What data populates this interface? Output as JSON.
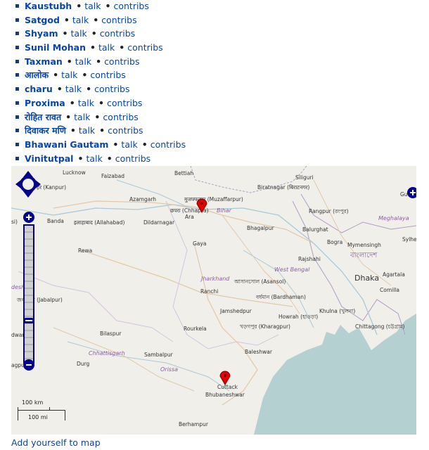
{
  "users": [
    {
      "name": "Kaustubh",
      "talk": "talk",
      "contribs": "contribs"
    },
    {
      "name": "Satgod",
      "talk": "talk",
      "contribs": "contribs"
    },
    {
      "name": "Shyam",
      "talk": "talk",
      "contribs": "contribs"
    },
    {
      "name": "Sunil Mohan",
      "talk": "talk",
      "contribs": "contribs"
    },
    {
      "name": "Taxman",
      "talk": "talk",
      "contribs": "contribs"
    },
    {
      "name": "आलोक",
      "talk": "talk",
      "contribs": "contribs"
    },
    {
      "name": "charu",
      "talk": "talk",
      "contribs": "contribs"
    },
    {
      "name": "Proxima",
      "talk": "talk",
      "contribs": "contribs"
    },
    {
      "name": "रोहित रावत",
      "talk": "talk",
      "contribs": "contribs"
    },
    {
      "name": "दिवाकर मणि",
      "talk": "talk",
      "contribs": "contribs"
    },
    {
      "name": "Bhawani Gautam",
      "talk": "talk",
      "contribs": "contribs"
    },
    {
      "name": "Vinitutpal",
      "talk": "talk",
      "contribs": "contribs"
    }
  ],
  "separator": "•",
  "map": {
    "places": {
      "lucknow": "Lucknow",
      "faizabad": "Faizabad",
      "bettiah": "Bettiah",
      "siliguri": "Siliguri",
      "kanpur": "हर (Kanpur)",
      "azamgarh": "Azamgarh",
      "muzaffarpur": "मुजफ्फरपुर (Muzaffarpur)",
      "biratnagar": "Biratnagar (बिराटनगर)",
      "chhapra": "छपरा (Chhapra)",
      "ara": "Ara",
      "banda": "Banda",
      "allahabad": "इलाहाबाद (Allahabad)",
      "dildarnagar": "Dildarnagar",
      "rangpur": "Rangpur (রংপুর)",
      "bhagalpur": "Bhagalpur",
      "balurghat": "Balurghat",
      "rewa": "Rewa",
      "gaya": "Gaya",
      "bogra": "Bogra",
      "mymensingh": "Mymensingh",
      "sylhet": "Sylhe",
      "rajshahi": "Rajshahi",
      "ranchi": "Ranchi",
      "asansol": "আসানসোল (Asansol)",
      "dhaka": "Dhaka",
      "bardhaman": "বর্ধমান (Bardhaman)",
      "jabalpur": "জবলপুর (Jabalpur)",
      "jamshedpur": "Jamshedpur",
      "howrah": "Howrah (হাওড়া)",
      "khulna": "Khulna (খুলনা)",
      "comilla": "Comilla",
      "agartala": "Agartala",
      "kharagpur": "খড়গপুর (Kharagpur)",
      "bilaspur": "Bilaspur",
      "rourkela": "Rourkela",
      "chittagong": "Chittagong (চট্টগ্রাম)",
      "baleshwar": "Baleshwar",
      "sambalpur": "Sambalpur",
      "durg": "Durg",
      "agpur": "agpur",
      "cuttack": "Cuttack",
      "bhubaneshwar": "Bhubaneshwar",
      "berhampur": "Berhampur",
      "si": "si)",
      "dwara": "dwara",
      "gu": "Gu"
    },
    "regions": {
      "bihar": "Bihar",
      "meghalaya": "Meghalaya",
      "jharkhand": "Jharkhand",
      "westbengal": "West Bengal",
      "chhattisgarh": "Chhattisgarh",
      "orissa": "Orissa",
      "desh": "desh"
    },
    "country_bangladesh": "বাংলাদেশ",
    "scale_km": "100 km",
    "scale_mi": "100 mi",
    "colors": {
      "land": "#f1efe9",
      "sea": "#b5d0d0",
      "river": "#a9c9da",
      "road": "#e2c9a7",
      "marker": "#e30000",
      "control": "#00008b"
    }
  },
  "add_link": "Add yourself to map"
}
